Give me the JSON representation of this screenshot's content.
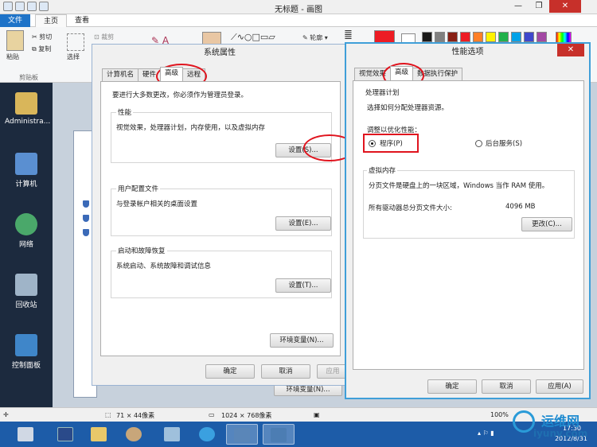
{
  "paint": {
    "title": "无标题 - 画图",
    "tabs": [
      "文件",
      "主页",
      "查看"
    ],
    "clipboard": {
      "paste_label": "粘贴",
      "cut_label": "剪切",
      "copy_label": "复制",
      "group_label": "剪贴板"
    },
    "select_label": "选择",
    "crop_label": "裁剪",
    "outline_label": "轮廓",
    "status": {
      "selection_size": "71 × 44像素",
      "canvas_size": "1024 × 768像素",
      "zoom": "100%"
    },
    "palette": [
      "#1a1a1a",
      "#808080",
      "#882015",
      "#ed1c24",
      "#ff7f27",
      "#fff200",
      "#22b14c",
      "#00a2e8",
      "#3f48cc",
      "#a349a4"
    ],
    "color1": "#ed1c24",
    "color2": "#ffffff"
  },
  "desktop": {
    "icons": [
      "Administra...",
      "计算机",
      "网络",
      "回收站",
      "控制面板"
    ]
  },
  "sysprops": {
    "title": "系统属性",
    "tabs": [
      "计算机名",
      "硬件",
      "高级",
      "远程"
    ],
    "selected_tab": "高级",
    "admin_note": "要进行大多数更改，你必须作为管理员登录。",
    "performance": {
      "title": "性能",
      "desc": "视觉效果，处理器计划，内存使用，以及虚拟内存",
      "button": "设置(S)..."
    },
    "profiles": {
      "title": "用户配置文件",
      "desc": "与登录帐户相关的桌面设置",
      "button": "设置(E)..."
    },
    "startup": {
      "title": "启动和故障恢复",
      "desc": "系统启动、系统故障和调试信息",
      "button": "设置(T)..."
    },
    "env_button": "环境变量(N)...",
    "ok": "确定",
    "cancel": "取消",
    "apply": "应用"
  },
  "perf": {
    "title": "性能选项",
    "tabs": [
      "视觉效果",
      "高级",
      "数据执行保护"
    ],
    "selected_tab": "高级",
    "cpu": {
      "title": "处理器计划",
      "desc": "选择如何分配处理器资源。",
      "adjust_label": "调整以优化性能：",
      "opt_programs": "程序(P)",
      "opt_services": "后台服务(S)",
      "selected": "程序(P)"
    },
    "vm": {
      "title": "虚拟内存",
      "desc": "分页文件是硬盘上的一块区域，Windows 当作 RAM 使用。",
      "total_label": "所有驱动器总分页文件大小:",
      "total_value": "4096 MB",
      "change_button": "更改(C)..."
    },
    "ok": "确定",
    "cancel": "取消",
    "apply": "应用(A)"
  },
  "behind_window": {
    "button_label": "环境变量(N)..."
  },
  "taskbar": {
    "time": "17:30",
    "date": "2012/8/31"
  },
  "watermark": {
    "brand": "运维网",
    "site": "iyunv.com"
  }
}
